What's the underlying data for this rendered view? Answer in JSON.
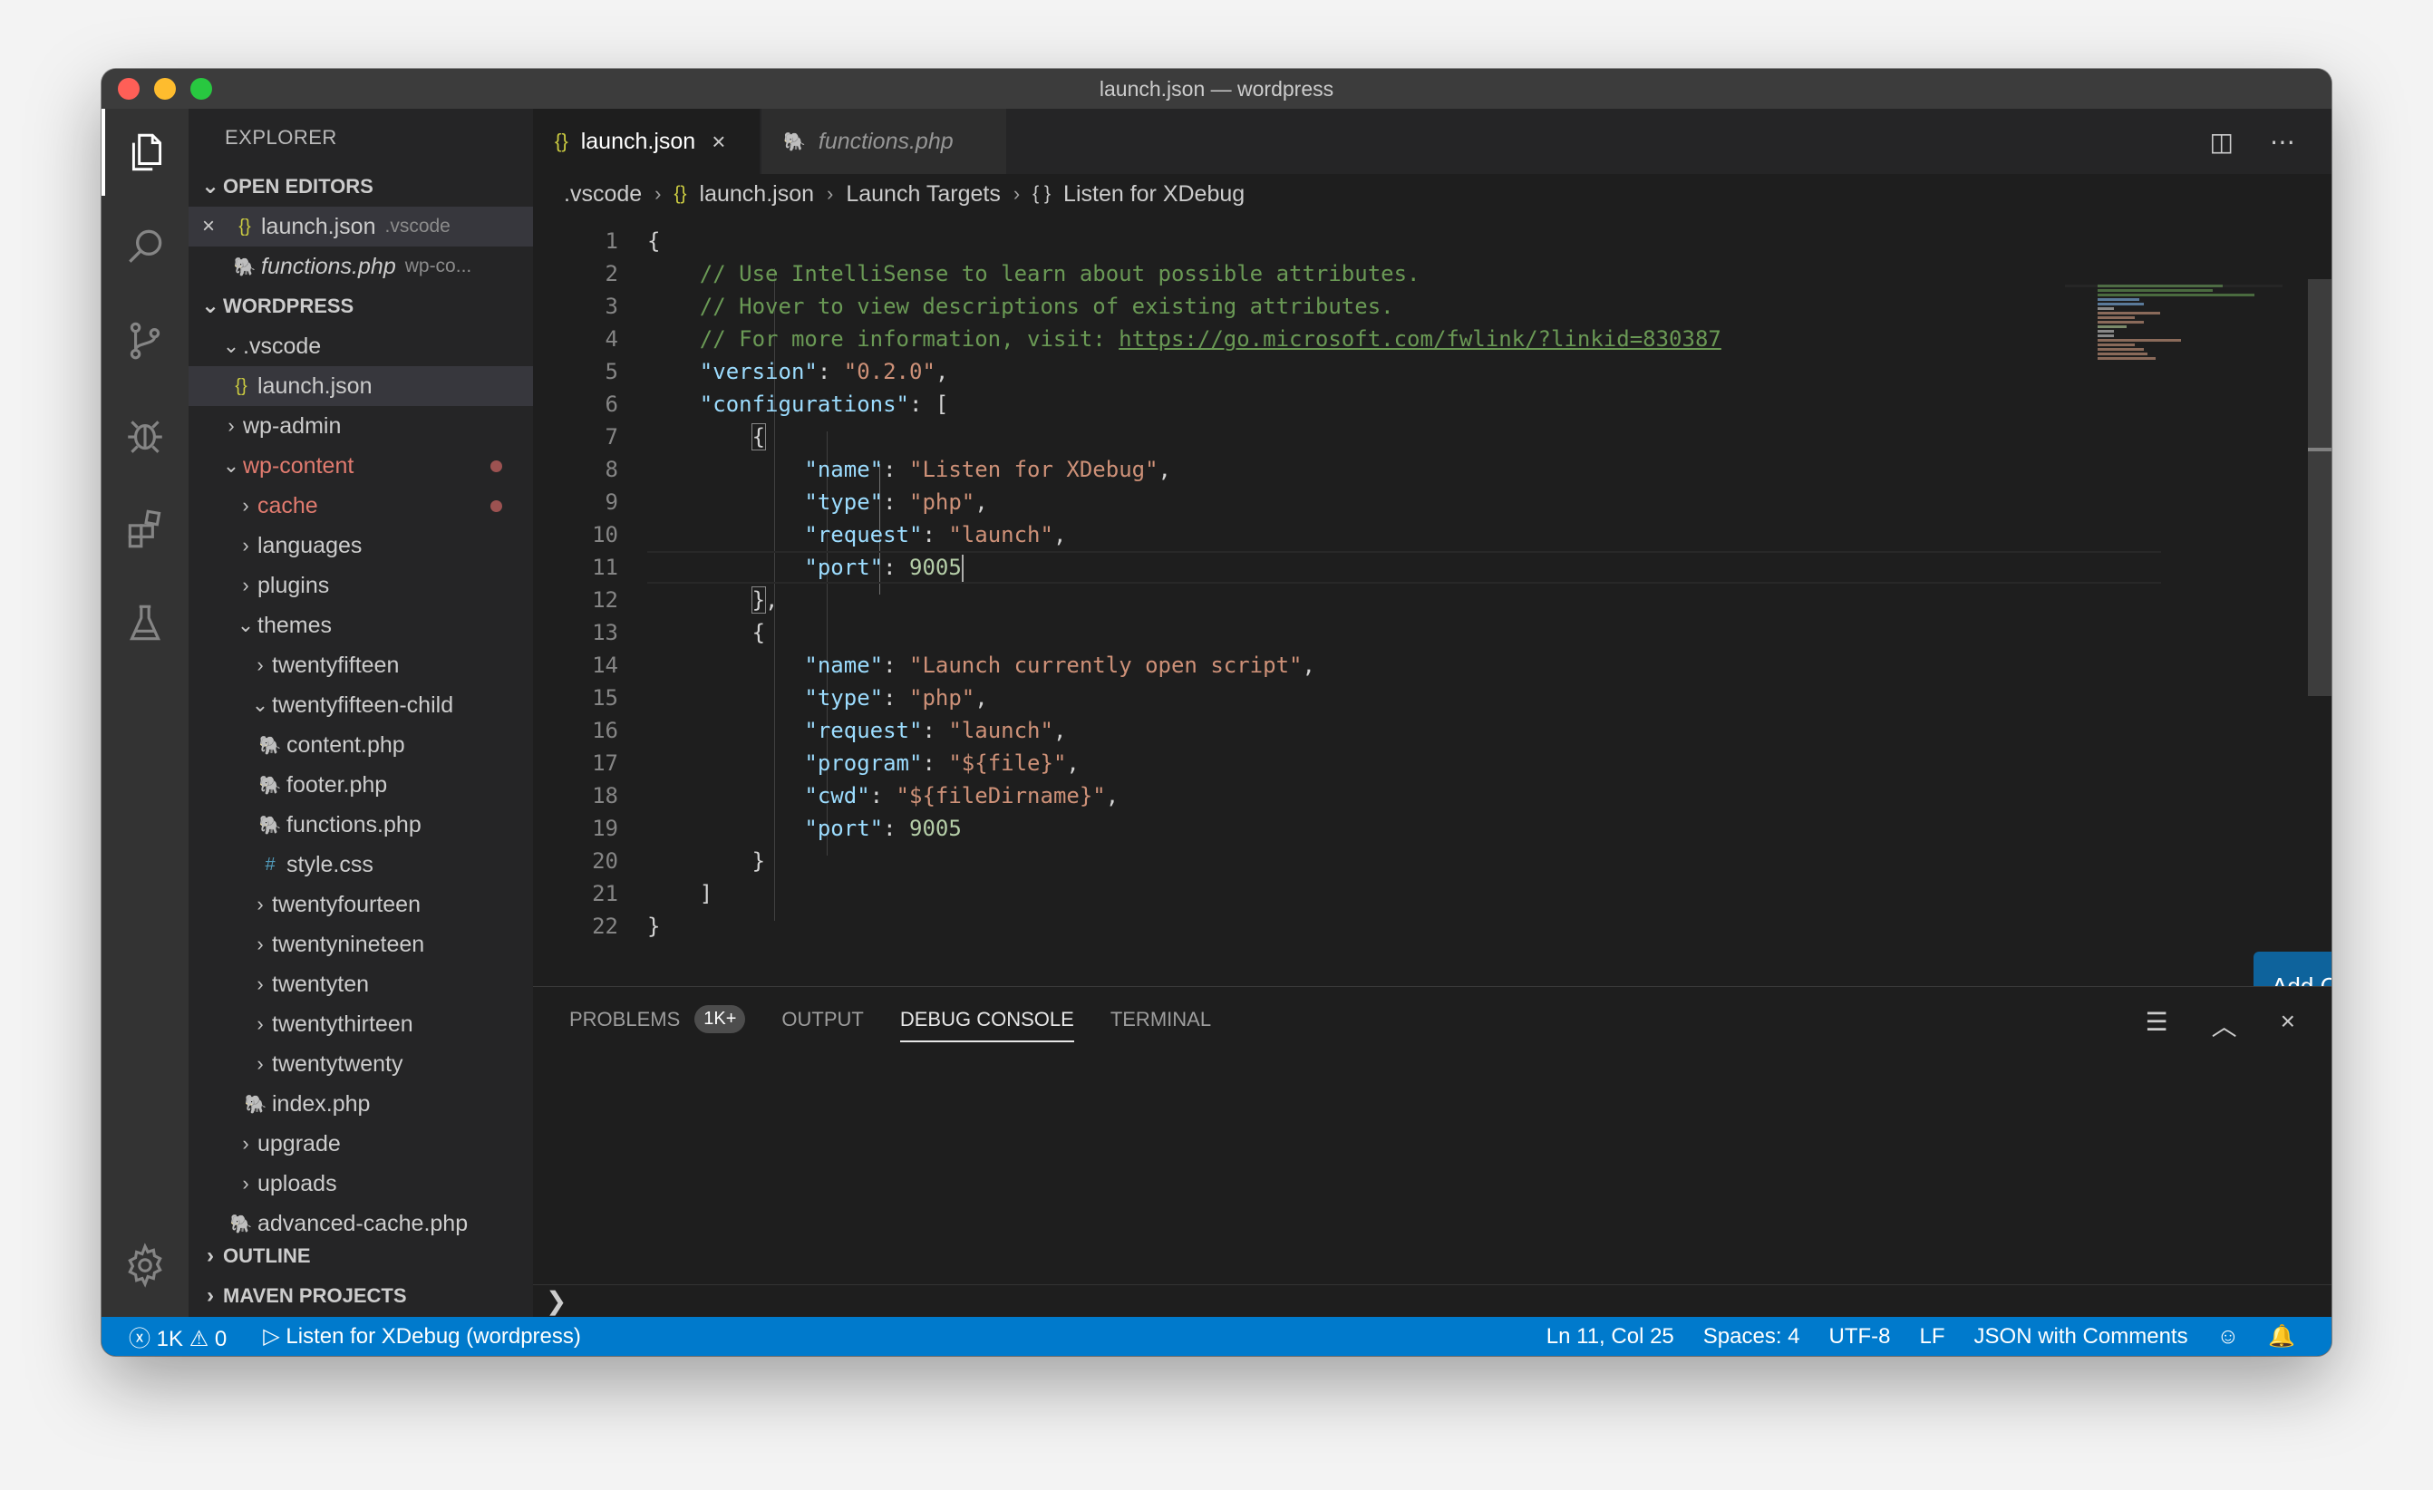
{
  "window": {
    "title": "launch.json — wordpress"
  },
  "sidebar": {
    "title": "EXPLORER",
    "open_editors": {
      "header": "OPEN EDITORS",
      "items": [
        {
          "name": "launch.json",
          "desc": ".vscode"
        },
        {
          "name": "functions.php",
          "desc": "wp-co..."
        }
      ]
    },
    "workspace_header": "WORDPRESS",
    "tree": [
      ".vscode",
      "launch.json",
      "wp-admin",
      "wp-content",
      "cache",
      "languages",
      "plugins",
      "themes",
      "twentyfifteen",
      "twentyfifteen-child",
      "content.php",
      "footer.php",
      "functions.php",
      "style.css",
      "twentyfourteen",
      "twentynineteen",
      "twentyten",
      "twentythirteen",
      "twentytwenty",
      "index.php",
      "upgrade",
      "uploads",
      "advanced-cache.php"
    ],
    "outline_header": "OUTLINE",
    "maven_header": "MAVEN PROJECTS"
  },
  "tabs": [
    {
      "label": "launch.json"
    },
    {
      "label": "functions.php"
    }
  ],
  "breadcrumbs": [
    ".vscode",
    "launch.json",
    "Launch Targets",
    "Listen for XDebug"
  ],
  "editor": {
    "line_numbers": [
      "1",
      "2",
      "3",
      "4",
      "5",
      "6",
      "7",
      "8",
      "9",
      "10",
      "11",
      "12",
      "13",
      "14",
      "15",
      "16",
      "17",
      "18",
      "19",
      "20",
      "21",
      "22"
    ],
    "comments": [
      "// Use IntelliSense to learn about possible attributes.",
      "// Hover to view descriptions of existing attributes.",
      "// For more information, visit: "
    ],
    "link": "https://go.microsoft.com/fwlink/?linkid=830387",
    "keys": {
      "version": "\"version\"",
      "configurations": "\"configurations\"",
      "name": "\"name\"",
      "type": "\"type\"",
      "request": "\"request\"",
      "port": "\"port\"",
      "program": "\"program\"",
      "cwd": "\"cwd\""
    },
    "values": {
      "version": "\"0.2.0\"",
      "name1": "\"Listen for XDebug\"",
      "php": "\"php\"",
      "launch": "\"launch\"",
      "port": "9005",
      "name2": "\"Launch currently open script\"",
      "program": "\"${file}\"",
      "cwd": "\"${fileDirname}\""
    },
    "add_config_button": "Add Configuration..."
  },
  "panel": {
    "tabs": [
      "PROBLEMS",
      "OUTPUT",
      "DEBUG CONSOLE",
      "TERMINAL"
    ],
    "problems_badge": "1K+",
    "prompt": "❯"
  },
  "statusbar": {
    "errors": "1K",
    "warnings": "0",
    "debug_target": "Listen for XDebug (wordpress)",
    "position": "Ln 11, Col 25",
    "spaces": "Spaces: 4",
    "encoding": "UTF-8",
    "eol": "LF",
    "language": "JSON with Comments"
  },
  "colors": {
    "accent": "#007acc",
    "button": "#0e639c",
    "modified": "#e17b6f"
  },
  "icons": [
    "files-icon",
    "search-icon",
    "source-control-icon",
    "debug-icon",
    "extensions-icon",
    "testing-icon",
    "gear-icon",
    "split-editor-icon",
    "more-icon",
    "clear-console-icon",
    "maximize-panel-icon",
    "close-panel-icon",
    "error-icon",
    "warning-icon",
    "play-icon",
    "feedback-icon",
    "bell-icon"
  ]
}
